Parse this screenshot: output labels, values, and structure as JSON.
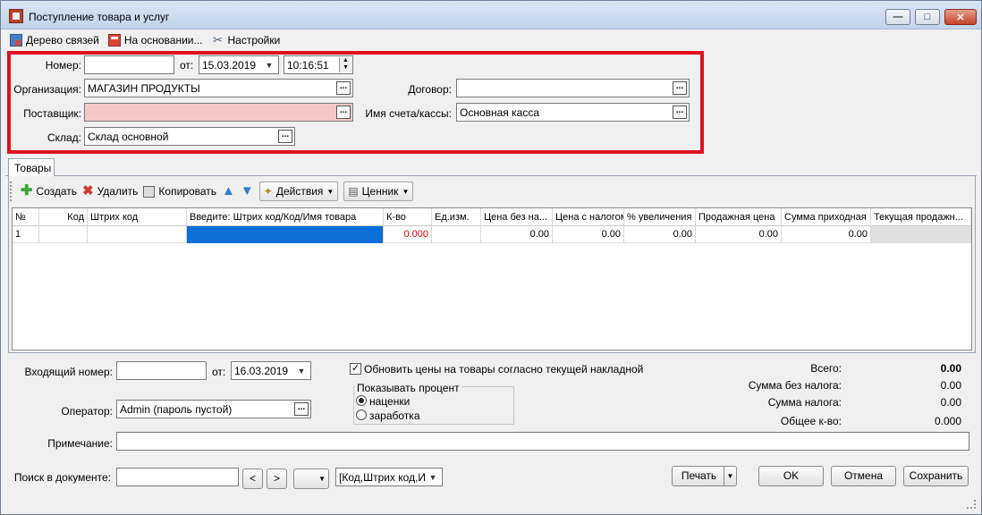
{
  "window": {
    "title": "Поступление товара и услуг",
    "controls": {
      "minimize": "—",
      "maximize": "□",
      "close": "✕"
    }
  },
  "toolbar": {
    "tree_label": "Дерево связей",
    "basis_label": "На основании...",
    "settings_label": "Настройки"
  },
  "header": {
    "number_label": "Номер:",
    "number_value": "",
    "date_label": "от:",
    "date_value": "15.03.2019",
    "time_value": "10:16:51",
    "org_label": "Организация:",
    "org_value": "МАГАЗИН ПРОДУКТЫ",
    "contract_label": "Договор:",
    "contract_value": "",
    "supplier_label": "Поставщик:",
    "supplier_value": "",
    "account_label": "Имя счета/кассы:",
    "account_value": "Основная касса",
    "warehouse_label": "Склад:",
    "warehouse_value": "Склад основной"
  },
  "tabs": [
    {
      "label": "Товары"
    }
  ],
  "grid_toolbar": {
    "create": "Создать",
    "delete": "Удалить",
    "copy": "Копировать",
    "actions": "Действия",
    "pricetag": "Ценник"
  },
  "grid": {
    "columns": [
      "№",
      "Код",
      "Штрих код",
      "Введите: Штрих код/Код/Имя товара",
      "К-во",
      "Ед.изм.",
      "Цена без на...",
      "Цена с налогом",
      "% увеличения",
      "Продажная цена",
      "Сумма приходная",
      "Текущая продажн..."
    ],
    "rows": [
      [
        "1",
        "",
        "",
        "",
        "0.000",
        "",
        "0.00",
        "0.00",
        "0.00",
        "0.00",
        "0.00",
        ""
      ]
    ]
  },
  "footer": {
    "incoming_label": "Входящий номер:",
    "incoming_value": "",
    "incoming_date_label": "от:",
    "incoming_date_value": "16.03.2019",
    "update_prices_label": "Обновить цены на товары согласно текущей накладной",
    "update_prices_checked": true,
    "show_percent_label": "Показывать процент",
    "radio_markup": "наценки",
    "radio_profit": "заработка",
    "operator_label": "Оператор:",
    "operator_value": "Admin (пароль пустой)",
    "note_label": "Примечание:",
    "note_value": "",
    "totals": {
      "total_label": "Всего:",
      "total_value": "0.00",
      "without_tax_label": "Сумма без налога:",
      "without_tax_value": "0.00",
      "tax_label": "Сумма налога:",
      "tax_value": "0.00",
      "qty_label": "Общее к-во:",
      "qty_value": "0.000"
    }
  },
  "bottom": {
    "search_label": "Поиск в документе:",
    "search_value": "",
    "prev": "<",
    "next": ">",
    "search_mode": "[Код,Штрих код,И",
    "print": "Печать",
    "ok": "OK",
    "cancel": "Отмена",
    "save": "Сохранить"
  },
  "colors": {
    "highlight_border": "#e0111f",
    "selected_cell": "#0a6fd7",
    "required_field": "#f6c9c9"
  }
}
